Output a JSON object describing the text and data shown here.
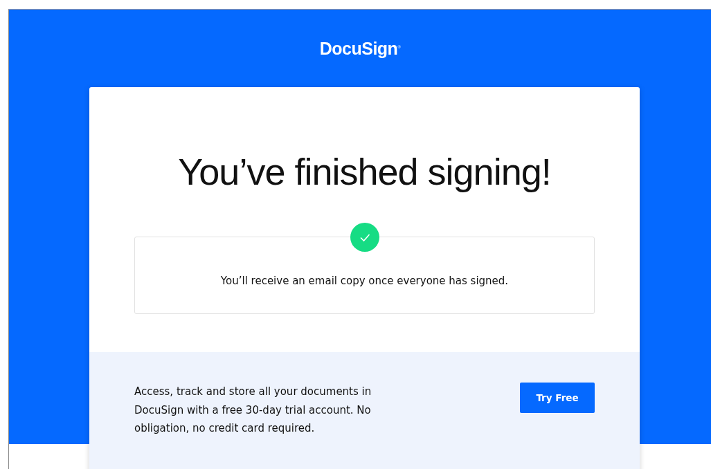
{
  "header": {
    "logo": "DocuSign$^{®}$"
  },
  "card": {
    "title": "You’ve finished signing!",
    "status": {
      "kind": "success",
      "message": "You’ll receive an email copy once everyone has signed."
    },
    "promo": {
      "text": "Access, track and store all your documents in DocuSign with a free 30-day trial account. No obligation, no credit card required.",
      "button": "Try Free"
    }
  }
}
